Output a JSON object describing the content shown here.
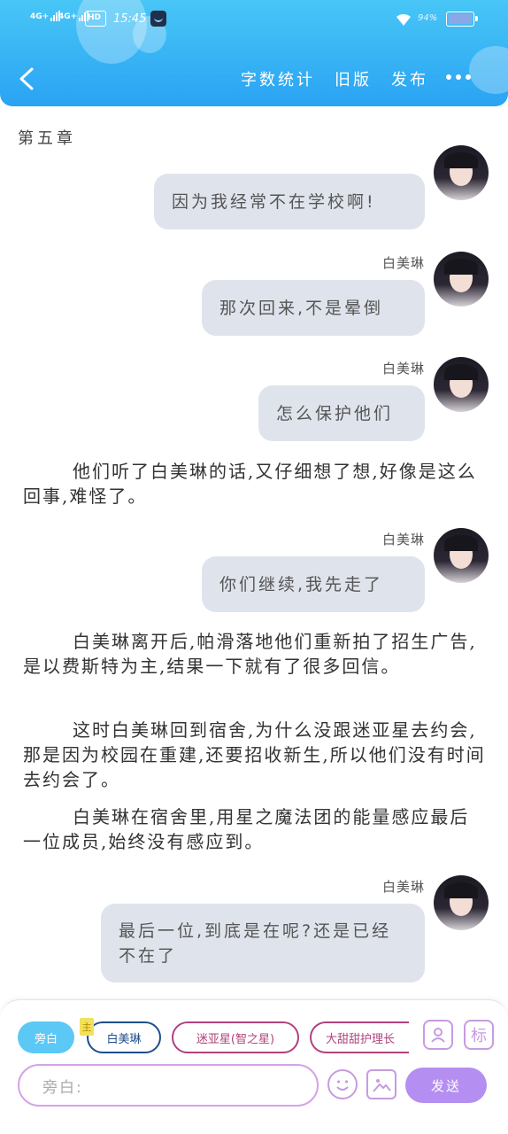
{
  "status_bar": {
    "network_1": "4G+",
    "network_2": "4G+",
    "hd_badge": "HD",
    "time": "15:45",
    "battery": "94%"
  },
  "header": {
    "actions": [
      "字数统计",
      "旧版",
      "发布"
    ]
  },
  "chapter_title": "第五章",
  "feed": [
    {
      "type": "message",
      "speaker": "",
      "text": "因为我经常不在学校啊!"
    },
    {
      "type": "message",
      "speaker": "白美琳",
      "text": "那次回来,不是晕倒"
    },
    {
      "type": "message",
      "speaker": "白美琳",
      "text": "怎么保护他们"
    },
    {
      "type": "narration",
      "text": "他们听了白美琳的话,又仔细想了想,好像是这么回事,难怪了。"
    },
    {
      "type": "message",
      "speaker": "白美琳",
      "text": "你们继续,我先走了"
    },
    {
      "type": "narration",
      "text": "白美琳离开后,帕滑落地他们重新拍了招生广告,是以费斯特为主,结果一下就有了很多回信。"
    },
    {
      "type": "narration",
      "text": "这时白美琳回到宿舍,为什么没跟迷亚星去约会,那是因为校园在重建,还要招收新生,所以他们没有时间去约会了。"
    },
    {
      "type": "narration",
      "text": "白美琳在宿舍里,用星之魔法团的能量感应最后一位成员,始终没有感应到。"
    },
    {
      "type": "message",
      "speaker": "白美琳",
      "text": "最后一位,到底是在呢?还是已经不在了"
    }
  ],
  "composer": {
    "roles": [
      {
        "label": "旁白",
        "selected": true
      },
      {
        "label": "白美琳",
        "tag": "主"
      },
      {
        "label": "迷亚星(智之星)"
      },
      {
        "label": "大甜甜护理长"
      }
    ],
    "placeholder": "旁白:",
    "send_label": "发送",
    "tag_icon_label": "标"
  },
  "colors": {
    "header_top": "#48c6f6",
    "header_bottom": "#2aa3f3",
    "bubble": "#dfe4ec",
    "send": "#b48ef0",
    "accent_purple": "#c79be0"
  }
}
